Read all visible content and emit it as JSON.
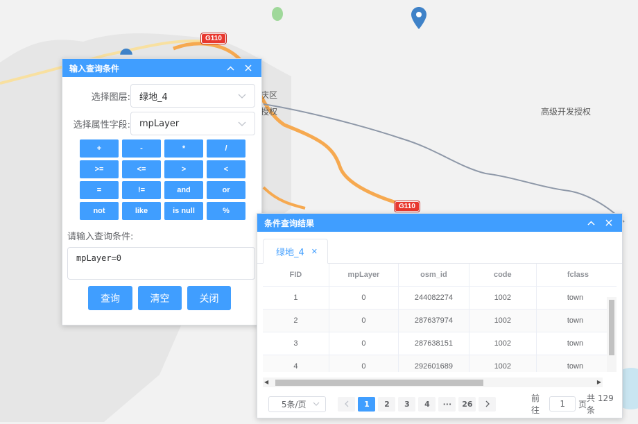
{
  "map": {
    "labels": [
      "庆区",
      "授权",
      "高级开发授权"
    ],
    "road_shields": [
      "G110",
      "G110"
    ],
    "colors": {
      "road_primary": "#f6a950",
      "road_secondary": "#f8e0a0",
      "railway": "#8e98a8",
      "water": "#a0d8f0",
      "park": "#9fd89a",
      "pin": "#3f82c8"
    }
  },
  "query_panel": {
    "title": "输入查询条件",
    "layer_label": "选择图层:",
    "layer_value": "绿地_4",
    "field_label": "选择属性字段:",
    "field_value": "mpLayer",
    "operators": [
      "+",
      "-",
      "*",
      "/",
      ">=",
      "<=",
      ">",
      "<",
      "=",
      "!=",
      "and",
      "or",
      "not",
      "like",
      "is null",
      "%"
    ],
    "condition_label": "请输入查询条件:",
    "condition_value": "mpLayer=0",
    "buttons": {
      "query": "查询",
      "clear": "清空",
      "close": "关闭"
    }
  },
  "results_panel": {
    "title": "条件查询结果",
    "tab": "绿地_4",
    "columns": [
      "FID",
      "mpLayer",
      "osm_id",
      "code",
      "fclass"
    ],
    "rows": [
      [
        "1",
        "0",
        "244082274",
        "1002",
        "town"
      ],
      [
        "2",
        "0",
        "287637974",
        "1002",
        "town"
      ],
      [
        "3",
        "0",
        "287638151",
        "1002",
        "town"
      ],
      [
        "4",
        "0",
        "292601689",
        "1002",
        "town"
      ]
    ],
    "pagination": {
      "page_size": "5条/页",
      "pages": [
        "1",
        "2",
        "3",
        "4",
        "···",
        "26"
      ],
      "current_page": "1",
      "goto_prefix": "前往",
      "goto_value": "1",
      "goto_suffix": "页",
      "total": "共 129 条"
    }
  },
  "colors": {
    "accent": "#409eff"
  }
}
